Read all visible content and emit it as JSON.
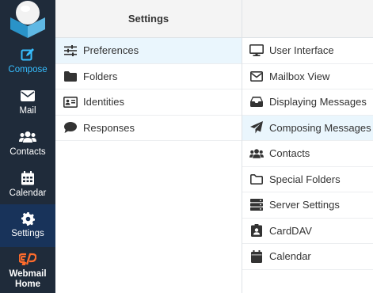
{
  "nav": {
    "items": [
      {
        "label": "Compose"
      },
      {
        "label": "Mail"
      },
      {
        "label": "Contacts"
      },
      {
        "label": "Calendar"
      },
      {
        "label": "Settings"
      },
      {
        "label": "Webmail Home"
      }
    ],
    "active_index": 4
  },
  "settings": {
    "title": "Settings",
    "sections": [
      {
        "label": "Preferences",
        "icon": "sliders-icon"
      },
      {
        "label": "Folders",
        "icon": "folder-icon"
      },
      {
        "label": "Identities",
        "icon": "id-card-icon"
      },
      {
        "label": "Responses",
        "icon": "comment-icon"
      }
    ],
    "selected_index": 0
  },
  "preferences": {
    "items": [
      {
        "label": "User Interface",
        "icon": "monitor-icon"
      },
      {
        "label": "Mailbox View",
        "icon": "envelope-icon"
      },
      {
        "label": "Displaying Messages",
        "icon": "inbox-icon"
      },
      {
        "label": "Composing Messages",
        "icon": "paper-plane-icon"
      },
      {
        "label": "Contacts",
        "icon": "users-icon"
      },
      {
        "label": "Special Folders",
        "icon": "folder-outline-icon"
      },
      {
        "label": "Server Settings",
        "icon": "server-icon"
      },
      {
        "label": "CardDAV",
        "icon": "address-card-icon"
      },
      {
        "label": "Calendar",
        "icon": "calendar-icon"
      }
    ],
    "selected_index": 3
  },
  "colors": {
    "nav_bg": "#1f2b3a",
    "nav_active_bg": "#18335a",
    "accent": "#37beff",
    "selected_row_bg": "#eaf6fd",
    "cpanel_orange": "#ff6c2c"
  }
}
